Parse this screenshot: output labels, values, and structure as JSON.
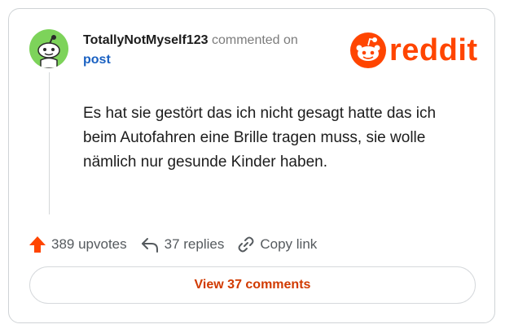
{
  "comment": {
    "author": "TotallyNotMyself123",
    "action_text": "commented on",
    "target_link": "post",
    "body": "Es hat sie gestört das ich nicht gesagt hatte das ich beim Autofahren eine Brille tragen muss, sie wolle nämlich nur gesunde Kinder haben.",
    "avatar_icon": "snoo-avatar-icon"
  },
  "brand": {
    "wordmark": "reddit",
    "logo_icon": "reddit-snoo-icon",
    "color": "#ff4500"
  },
  "actions": {
    "upvotes_label": "389 upvotes",
    "replies_label": "37 replies",
    "copy_link_label": "Copy link"
  },
  "footer": {
    "view_comments_label": "View 37 comments"
  },
  "colors": {
    "avatar_bg": "#7dd35a",
    "link": "#1a61c2",
    "accent": "#ff4500",
    "button_text": "#d13a00"
  }
}
